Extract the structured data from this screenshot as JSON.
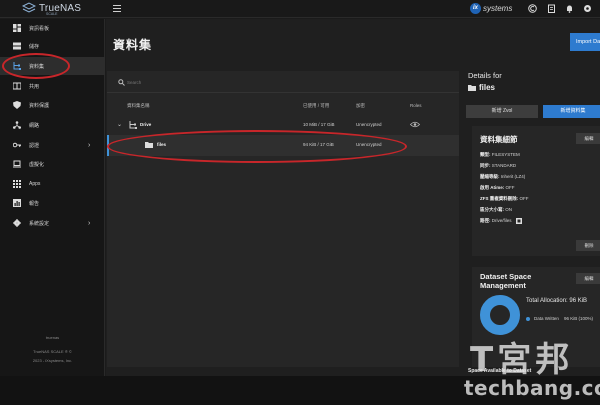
{
  "topbar": {
    "brand": "TrueNAS",
    "brand_sub": "SCALE",
    "vendor_badge": "ix",
    "vendor": "systems",
    "icons": [
      "hamburger-icon",
      "truecommand-icon",
      "clipboard-icon",
      "bell-icon",
      "settings-icon"
    ]
  },
  "sidebar": {
    "items": [
      {
        "label": "資訊看板",
        "icon": "dashboard-icon"
      },
      {
        "label": "儲存",
        "icon": "storage-icon"
      },
      {
        "label": "資料集",
        "icon": "datasets-icon"
      },
      {
        "label": "共用",
        "icon": "shares-icon"
      },
      {
        "label": "資料保護",
        "icon": "shield-icon"
      },
      {
        "label": "網路",
        "icon": "network-icon"
      },
      {
        "label": "認證",
        "icon": "key-icon"
      },
      {
        "label": "虛擬化",
        "icon": "laptop-icon"
      },
      {
        "label": "Apps",
        "icon": "apps-icon"
      },
      {
        "label": "報告",
        "icon": "reports-icon"
      },
      {
        "label": "系統設定",
        "icon": "gear-icon"
      }
    ],
    "footer": [
      "truenas",
      "TrueNAS SCALE ® ©",
      "2023 - iXsystems, Inc."
    ]
  },
  "main": {
    "title": "資料集",
    "import_button": "Import Da",
    "search_placeholder": "Search",
    "columns": [
      "資料集名稱",
      "已使用 / 可用",
      "加密",
      "Roles"
    ],
    "rows": [
      {
        "name": "Drive",
        "used": "10 MiB / 17 GiB",
        "encryption": "Unencrypted",
        "has_roles_icon": true
      },
      {
        "name": "files",
        "used": "94 KiB / 17 GiB",
        "encryption": "Unencrypted",
        "has_roles_icon": false
      }
    ]
  },
  "details": {
    "header": "Details for",
    "selected": "files",
    "add_zvol": "新增 Zvol",
    "add_dataset": "新增資料集",
    "info_card": {
      "title": "資料集細節",
      "edit": "編輯",
      "lines": [
        {
          "label": "類型:",
          "value": "FILESYSTEM"
        },
        {
          "label": "同步:",
          "value": "STANDARD"
        },
        {
          "label": "壓縮等級:",
          "value": "Inherit (LZ4)"
        },
        {
          "label": "啟用 Atime:",
          "value": "OFF"
        },
        {
          "label": "ZFS 重複資料刪除:",
          "value": "OFF"
        },
        {
          "label": "區分大小寫:",
          "value": "ON"
        },
        {
          "label": "路徑:",
          "value": "Drive/files"
        }
      ],
      "delete": "刪除"
    },
    "space_card": {
      "title_line1": "Dataset Space",
      "title_line2": "Management",
      "edit": "編輯",
      "total_allocation": "Total Allocation: 96 KiB",
      "legend_label": "Data Written",
      "legend_value": "96 KiB (100%)",
      "data_written_fraction": 1.0
    },
    "space_available": "Space Available to Dataset"
  },
  "watermark": {
    "glyphs": "T宮邦",
    "text": "techbang.com"
  },
  "colors": {
    "accent": "#2e7bcf",
    "annotation": "#c8262a",
    "background": "#1f1f1f"
  }
}
